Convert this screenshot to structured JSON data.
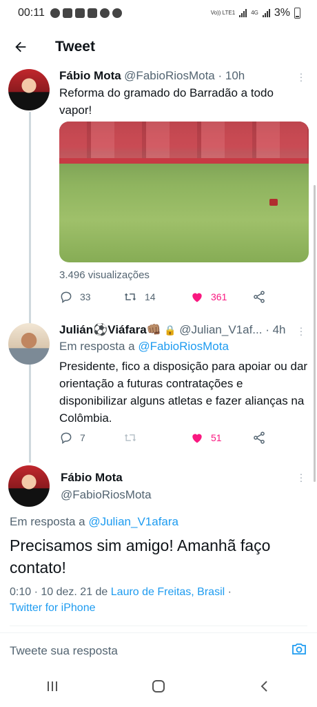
{
  "status_bar": {
    "time": "00:11",
    "battery": "3%",
    "network_left": "Vo)) LTE1",
    "network_right": "4G"
  },
  "header": {
    "title": "Tweet"
  },
  "tweet1": {
    "name": "Fábio Mota",
    "handle_time": "@FabioRiosMota · 10h",
    "text": "Reforma do gramado do Barradão a todo vapor!",
    "views": "3.496 visualizações",
    "replies": "33",
    "retweets": "14",
    "likes": "361"
  },
  "tweet2": {
    "name": "Julián⚽Viáfara👊🏽",
    "handle_time": "@Julian_V1af... · 4h",
    "reply_prefix": "Em resposta a ",
    "reply_handle": "@FabioRiosMota",
    "text": "Presidente, fico a disposição para apoiar ou dar orientação a futuras contratações e disponibilizar alguns atletas e fazer alianças na Colômbia.",
    "replies": "7",
    "likes": "51"
  },
  "main_tweet": {
    "name": "Fábio Mota",
    "handle": "@FabioRiosMota",
    "reply_prefix": "Em resposta a ",
    "reply_handle": "@Julian_V1afara",
    "text": "Precisamos sim amigo! Amanhã faço contato!",
    "time_date": "0:10 · 10 dez. 21 de ",
    "location": "Lauro de Freitas, Brasil",
    "sep": " ·",
    "source": "Twitter for iPhone"
  },
  "reply_bar": {
    "placeholder": "Tweete sua resposta"
  },
  "colors": {
    "link": "#1d9bf0",
    "like": "#f91880",
    "muted": "#536471"
  }
}
